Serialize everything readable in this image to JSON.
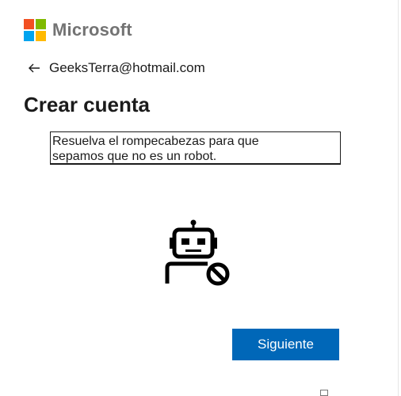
{
  "brand": {
    "name": "Microsoft",
    "colors": {
      "red": "#f25022",
      "green": "#7fba00",
      "blue": "#00a4ef",
      "yellow": "#ffb900"
    }
  },
  "identity": {
    "back_icon": "arrow-left-icon",
    "email": "GeeksTerra@hotmail.com"
  },
  "page": {
    "title": "Crear cuenta"
  },
  "challenge": {
    "instruction_line1": "Resuelva el rompecabezas para que",
    "instruction_line2": "sepamos que no es un robot.",
    "icon": "robot-blocked-icon"
  },
  "actions": {
    "next_label": "Siguiente",
    "accent_color": "#0067b8"
  }
}
